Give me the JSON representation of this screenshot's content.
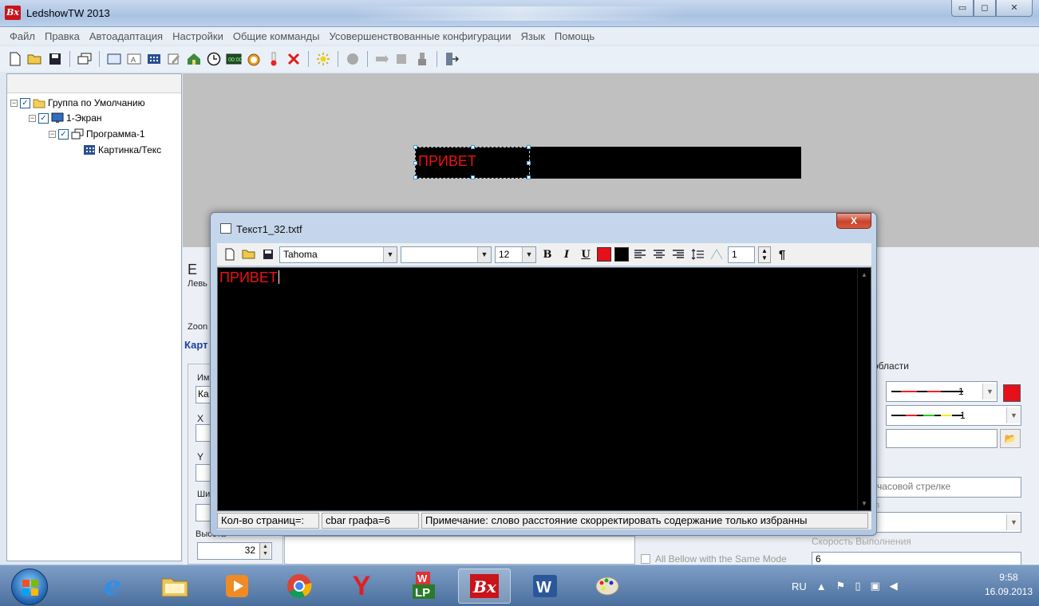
{
  "window": {
    "title": "LedshowTW 2013",
    "app_icon_text": "Bx",
    "buttons": {
      "minimize": "▭",
      "maximize": "◻",
      "close": "✕"
    }
  },
  "menu": [
    "Файл",
    "Правка",
    "Автоадаптация",
    "Настройки",
    "Общие комманды",
    "Усовершенствованные конфигурации",
    "Язык",
    "Помощь"
  ],
  "toolbar_icons": [
    "new-icon",
    "open-icon",
    "save-icon",
    "sep",
    "copy-icon",
    "sep",
    "area-icon",
    "text-area-icon",
    "grid-icon",
    "edit-icon",
    "house-icon",
    "clock-icon",
    "timer-icon",
    "alarm-icon",
    "temperature-icon",
    "delete-icon",
    "sep",
    "brightness-icon",
    "sep",
    "record-icon",
    "send-icon",
    "send2-icon",
    "usb-icon",
    "sep",
    "exit-icon"
  ],
  "tree": {
    "items": [
      {
        "label": "Группа по Умолчанию"
      },
      {
        "label": "1-Экран"
      },
      {
        "label": "Программа-1"
      },
      {
        "label": "Картинка/Текс"
      }
    ]
  },
  "preview": {
    "led_text": "ПРИВЕТ"
  },
  "props": {
    "tab_label": "Левь",
    "zoom_label": "Zoon",
    "section_title": "Карт",
    "name_label": "Им",
    "name_value": "Ка",
    "x_label": "X",
    "y_label": "Y",
    "width_label": "Ши",
    "height_label": "Высота",
    "height_value": "32",
    "area_group": "а области",
    "border_val1": "1",
    "border_val2": "1",
    "clockwise": "о часовой стрелке",
    "speed_label": "Скорость Выполнения",
    "speed_value": "6",
    "all_bellow": "All Bellow with the Same Mode",
    "value_6": "6",
    "faded_label": "ния"
  },
  "dialog": {
    "title": "Текст1_32.txtf",
    "font": "Tahoma",
    "style_value": "",
    "size": "12",
    "line_spacing": "1",
    "editor_text": "ПРИВЕТ",
    "status": {
      "pages": "Кол-во страниц=:",
      "chars": "cbar графа=6",
      "note": "Примечание: слово расстояние скорректировать содержание только избранны"
    },
    "colors": {
      "fore": "#e5101a",
      "back": "#000000"
    }
  },
  "taskbar": {
    "apps": [
      "ie-icon",
      "explorer-icon",
      "media-icon",
      "chrome-icon",
      "yandex-icon",
      "word-lp-icon",
      "ledshow-icon",
      "word-icon",
      "paint-icon"
    ],
    "lang": "RU",
    "time": "9:58",
    "date": "16.09.2013"
  }
}
